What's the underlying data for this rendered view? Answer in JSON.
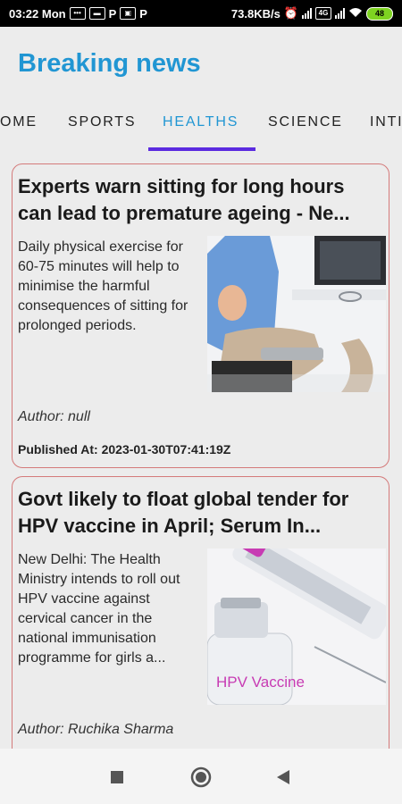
{
  "status_bar": {
    "time": "03:22 Mon",
    "net_speed": "73.8KB/s",
    "battery": "48",
    "p1": "P",
    "p2": "P",
    "icons": [
      "chat-icon",
      "message-icon",
      "p-icon",
      "image-icon",
      "p-icon",
      "alarm-icon",
      "signal-icon",
      "wifi-icon",
      "battery-icon"
    ]
  },
  "header": {
    "title": "Breaking news"
  },
  "tabs": [
    {
      "label": "OME"
    },
    {
      "label": "SPORTS"
    },
    {
      "label": "HEALTHS",
      "active": true
    },
    {
      "label": "SCIENCE"
    },
    {
      "label": "INTI"
    }
  ],
  "articles": [
    {
      "title": "Experts warn sitting for long hours can lead to premature ageing - Ne...",
      "description": "Daily physical exercise for 60-75 minutes will help to minimise the harmful consequences of sitting for prolonged periods.",
      "author": "Author: null",
      "published": "Published At: 2023-01-30T07:41:19Z"
    },
    {
      "title": "Govt likely to float global tender for HPV vaccine in April; Serum In...",
      "description": "New Delhi: The Health Ministry intends to roll out HPV vaccine against cervical cancer in the national immunisation programme for girls a...",
      "author": "Author: Ruchika Sharma",
      "image_text": "HPV Vaccine"
    }
  ],
  "nav": {
    "buttons": [
      "recent-apps-icon",
      "home-icon",
      "back-icon"
    ]
  },
  "colors": {
    "accent": "#2196d3",
    "indicator": "#5b2be0",
    "card_border": "#d47a7a"
  }
}
